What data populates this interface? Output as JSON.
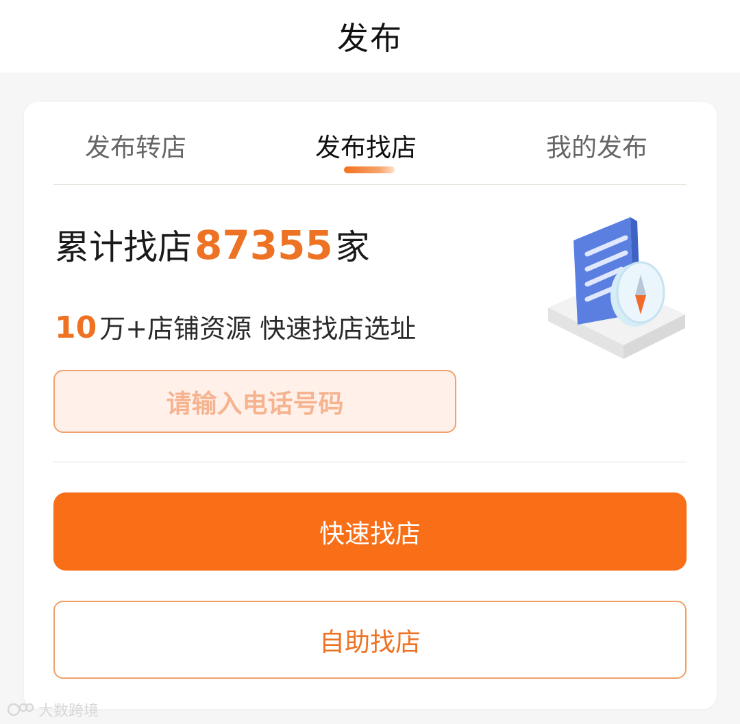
{
  "header": {
    "title": "发布"
  },
  "tabs": [
    {
      "label": "发布转店",
      "active": false
    },
    {
      "label": "发布找店",
      "active": true
    },
    {
      "label": "我的发布",
      "active": false
    }
  ],
  "stats": {
    "prefix": "累计找店",
    "count": "87355",
    "suffix": "家"
  },
  "tagline": {
    "number": "10",
    "text": "万+店铺资源 快速找店选址"
  },
  "phone_input": {
    "placeholder": "请输入电话号码"
  },
  "buttons": {
    "primary": "快速找店",
    "secondary": "自助找店"
  },
  "illustration": {
    "icon": "document-compass-icon"
  },
  "watermark": {
    "text": "大数跨境"
  },
  "colors": {
    "accent": "#f96f17",
    "accent_text": "#ee7223",
    "input_bg": "#fff1ea"
  }
}
